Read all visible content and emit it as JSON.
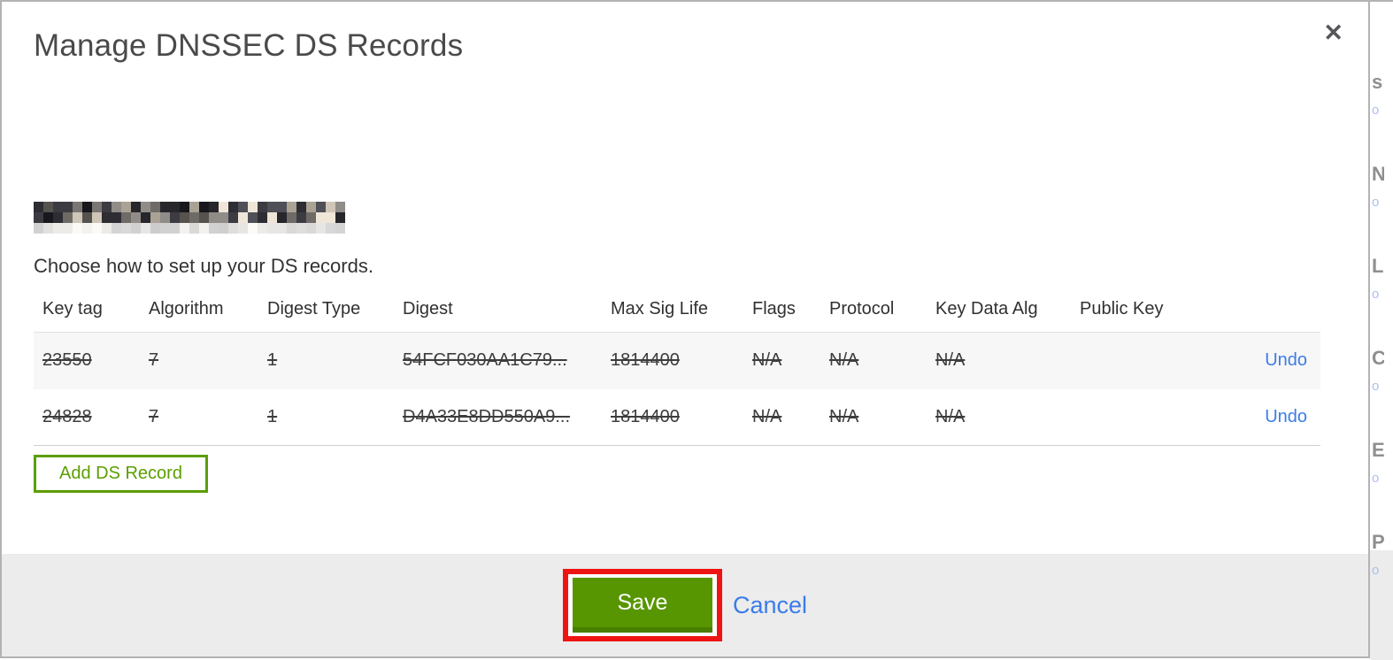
{
  "modal": {
    "title": "Manage DNSSEC DS Records",
    "close_glyph": "✕",
    "instruction": "Choose how to set up your DS records.",
    "table": {
      "headers": [
        "Key tag",
        "Algorithm",
        "Digest Type",
        "Digest",
        "Max Sig Life",
        "Flags",
        "Protocol",
        "Key Data Alg",
        "Public Key"
      ],
      "rows": [
        {
          "cells": [
            "23550",
            "7",
            "1",
            "54FCF030AA1C79...",
            "1814400",
            "N/A",
            "N/A",
            "N/A",
            ""
          ],
          "action": "Undo",
          "struck": true
        },
        {
          "cells": [
            "24828",
            "7",
            "1",
            "D4A33E8DD550A9...",
            "1814400",
            "N/A",
            "N/A",
            "N/A",
            ""
          ],
          "action": "Undo",
          "struck": true
        }
      ]
    },
    "add_button_label": "Add DS Record",
    "footer": {
      "save_label": "Save",
      "cancel_label": "Cancel"
    }
  },
  "annotation": {
    "type": "highlight-box",
    "color": "#ee1414",
    "target": "save-button"
  },
  "colors": {
    "action_green": "#579600",
    "action_green_dark": "#497e00",
    "outline_green": "#5c9e00",
    "link_blue": "#3d7ce8",
    "footer_gray": "#ececec",
    "row_stripe_gray": "#f7f7f7",
    "modal_border_gray": "#b3b3b3"
  },
  "background_page": {
    "edge_fragments": [
      "s",
      "N",
      "L",
      "C",
      "E",
      "P"
    ]
  }
}
